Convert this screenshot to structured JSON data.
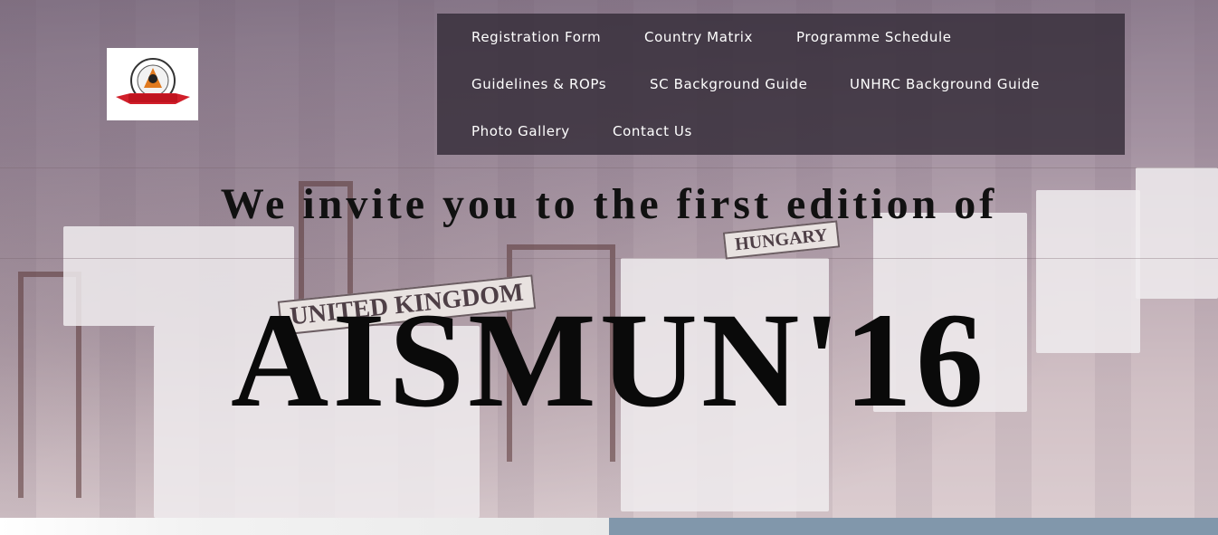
{
  "colors": {
    "nav_background": "#342c38",
    "nav_text": "#ffffff",
    "heading_text": "#111111",
    "footer_right": "#8197ab",
    "logo_banner": "#d11f2a"
  },
  "logo": {
    "icon": "aismun-logo-icon"
  },
  "nav": {
    "items": [
      {
        "label": "Registration Form"
      },
      {
        "label": "Country Matrix"
      },
      {
        "label": "Programme Schedule"
      },
      {
        "label": "Guidelines & ROPs"
      },
      {
        "label": "SC Background Guide"
      },
      {
        "label": "UNHRC Background Guide"
      },
      {
        "label": "Photo Gallery"
      },
      {
        "label": "Contact Us"
      }
    ]
  },
  "hero": {
    "invite_text": "We invite you to the first edition of",
    "title": "AISMUN'16",
    "placards": [
      "UNITED KINGDOM",
      "HUNGARY"
    ]
  }
}
